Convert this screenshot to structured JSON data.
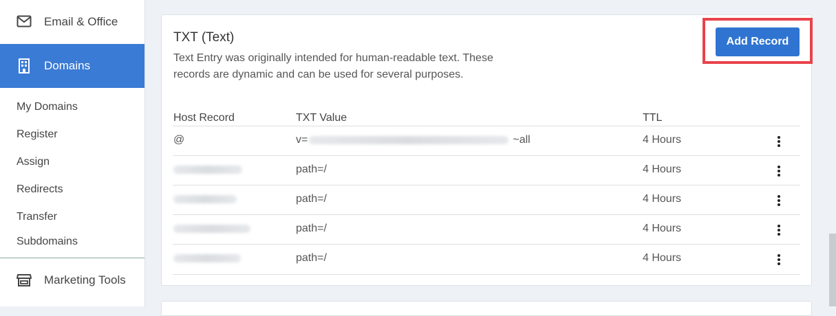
{
  "sidebar": {
    "top_item": {
      "label": "Email & Office",
      "icon": "envelope-icon"
    },
    "active_item": {
      "label": "Domains",
      "icon": "building-icon"
    },
    "sub_items": [
      "My Domains",
      "Register",
      "Assign",
      "Redirects",
      "Transfer",
      "Subdomains"
    ],
    "bottom_item": {
      "label": "Marketing Tools",
      "icon": "storefront-icon"
    }
  },
  "card": {
    "title": "TXT (Text)",
    "description": "Text Entry was originally intended for human-readable text. These records are dynamic and can be used for several purposes.",
    "add_button": "Add Record"
  },
  "table": {
    "headers": [
      "Host Record",
      "TXT Value",
      "TTL"
    ],
    "rows": [
      {
        "host": "@",
        "value_prefix": "v=",
        "value_suffix": "~all",
        "ttl": "4 Hours"
      },
      {
        "host": "",
        "value_prefix": "path=/",
        "value_suffix": "",
        "ttl": "4 Hours"
      },
      {
        "host": "",
        "value_prefix": "path=/",
        "value_suffix": "",
        "ttl": "4 Hours"
      },
      {
        "host": "",
        "value_prefix": "path=/",
        "value_suffix": "",
        "ttl": "4 Hours"
      },
      {
        "host": "",
        "value_prefix": "path=/",
        "value_suffix": "",
        "ttl": "4 Hours"
      }
    ]
  },
  "colors": {
    "accent": "#3a7bd5",
    "button": "#2f74d0",
    "highlight_box": "#e8434b"
  }
}
